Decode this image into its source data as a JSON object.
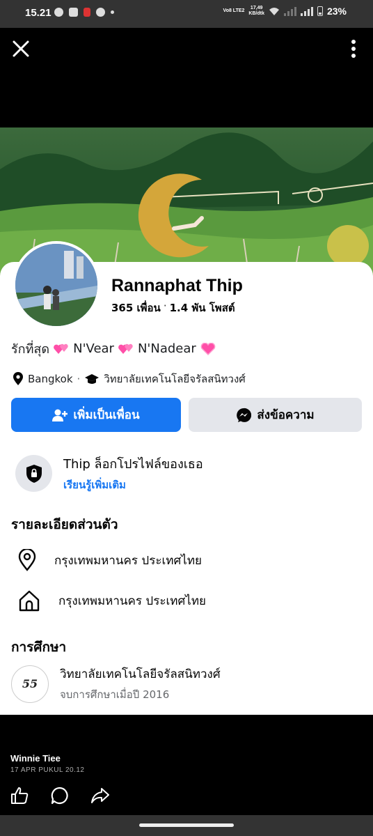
{
  "status_bar": {
    "time": "15.21",
    "volte": "Vo8 LTE2",
    "speed_value": "17,49",
    "speed_unit": "KB/dtk",
    "battery": "23%"
  },
  "profile": {
    "name": "Rannaphat Thip",
    "friends": "365 เพื่อน",
    "dot": "·",
    "posts": "1.4 พัน โพสต์",
    "bio_prefix": "รักที่สุด",
    "bio_name1": "N'Vear",
    "bio_name2": "N'Nadear",
    "location": "Bangkok",
    "meta_sep": "·",
    "school": "วิทยาลัยเทคโนโลยีจรัลสนิทวงศ์"
  },
  "buttons": {
    "add_friend": "เพิ่มเป็นเพื่อน",
    "message": "ส่งข้อความ"
  },
  "lock_notice": {
    "title": "Thip ล็อกโปรไฟล์ของเธอ",
    "link": "เรียนรู้เพิ่มเติม"
  },
  "details": {
    "title": "รายละเอียดส่วนตัว",
    "current_city": "กรุงเทพมหานคร ประเทศไทย",
    "hometown": "กรุงเทพมหานคร ประเทศไทย"
  },
  "education": {
    "title": "การศึกษา",
    "logo_text": "55",
    "school": "วิทยาลัยเทคโนโลยีจรัลสนิทวงศ์",
    "graduated": "จบการศึกษาเมื่อปี 2016"
  },
  "post_footer": {
    "poster": "Winnie Tiee",
    "date": "17 APR PUKUL 20.12"
  },
  "icons": [
    "close-icon",
    "more-icon",
    "add-friend-icon",
    "messenger-icon",
    "shield-lock-icon",
    "location-pin-icon",
    "home-icon",
    "graduation-cap-icon",
    "like-icon",
    "comment-icon",
    "share-icon"
  ],
  "colors": {
    "primary": "#1877f2",
    "secondary_button": "#e4e6eb",
    "heart": "#ff4fa8"
  }
}
